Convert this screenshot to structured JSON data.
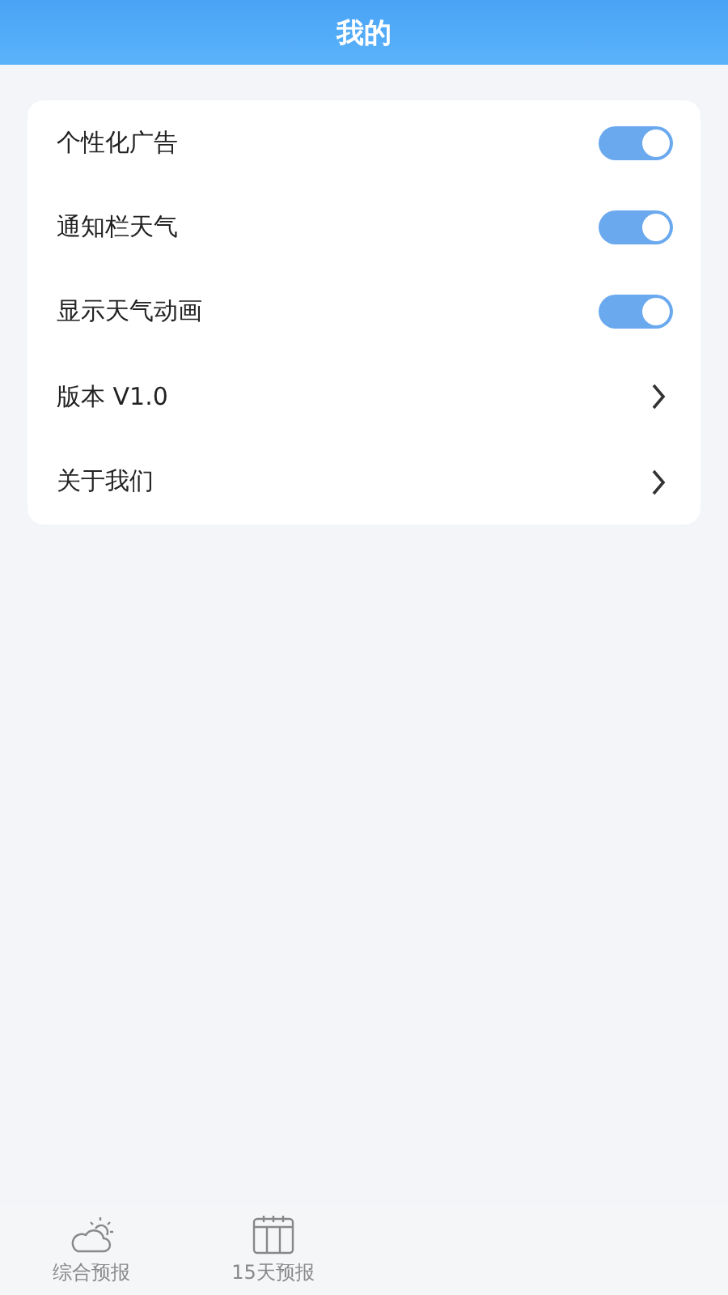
{
  "header": {
    "title": "我的"
  },
  "settings": [
    {
      "kind": "toggle",
      "label": "个性化广告",
      "on": true
    },
    {
      "kind": "toggle",
      "label": "通知栏天气",
      "on": true
    },
    {
      "kind": "toggle",
      "label": "显示天气动画",
      "on": true
    },
    {
      "kind": "link",
      "label": "版本 V1.0"
    },
    {
      "kind": "link",
      "label": "关于我们"
    }
  ],
  "tab_bar": [
    {
      "kind": "cloud-sun",
      "label": "综合预报",
      "selected": false
    },
    {
      "kind": "calendar",
      "label": "15天预报",
      "selected": false
    }
  ]
}
